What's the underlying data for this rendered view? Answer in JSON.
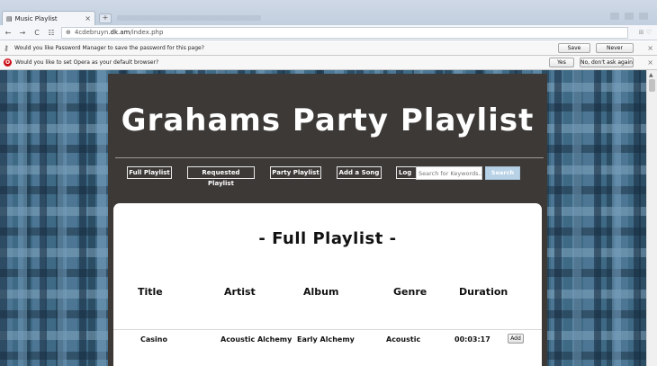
{
  "browser": {
    "tab_title": "Music Playlist",
    "tab_close": "×",
    "new_tab": "+",
    "back": "←",
    "forward": "→",
    "reload": "C",
    "grid": "☷",
    "url_prefix": "4cdebruyn.",
    "url_host": "dk.am",
    "url_path": "/index.php",
    "addr_right": "⊞ ♡"
  },
  "infobars": {
    "password": {
      "message": "Would you like Password Manager to save the password for this page?",
      "save_label": "Save",
      "never_label": "Never",
      "close": "×"
    },
    "opera": {
      "message": "Would you like to set Opera as your default browser?",
      "yes_label": "Yes",
      "no_label": "No, don't ask again",
      "close": "×"
    }
  },
  "site": {
    "title": "Grahams Party Playlist",
    "nav": [
      {
        "label": "Full Playlist"
      },
      {
        "label": "Requested Playlist"
      },
      {
        "label": "Party Playlist"
      },
      {
        "label": "Add a Song"
      },
      {
        "label": "Log"
      }
    ],
    "search": {
      "placeholder": "Search for Keywords...",
      "button_label": "Search"
    }
  },
  "playlist": {
    "heading": "- Full Playlist -",
    "columns": [
      "Title",
      "Artist",
      "Album",
      "Genre",
      "Duration"
    ],
    "rows": [
      {
        "title": "Casino",
        "artist": "Acoustic Alchemy",
        "album": "Early Alchemy",
        "genre": "Acoustic",
        "duration": "00:03:17",
        "action": "Add"
      }
    ]
  },
  "colors": {
    "wrapper_bg": "#3c3937",
    "search_button": "#b7d1e6",
    "opera_red": "#cc0f16"
  }
}
